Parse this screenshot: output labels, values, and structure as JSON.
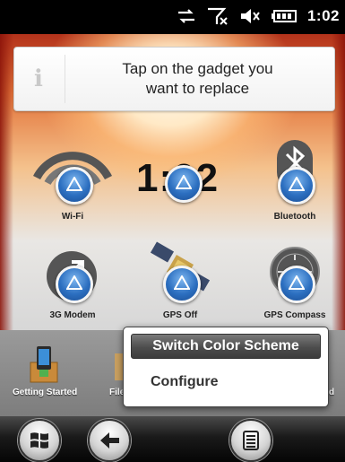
{
  "status_bar": {
    "time": "1:02",
    "icons": [
      "sync-arrows-icon",
      "no-signal-icon",
      "volume-muted-icon",
      "battery-icon"
    ]
  },
  "banner": {
    "icon": "info-icon",
    "line1": "Tap on the gadget you",
    "line2": "want to replace"
  },
  "gadgets": {
    "wifi": {
      "label": "Wi-Fi",
      "icon": "wifi-icon"
    },
    "clock": {
      "text": "1:02"
    },
    "bluetooth": {
      "label": "Bluetooth",
      "icon": "bluetooth-icon"
    },
    "modem": {
      "label": "3G Modem",
      "icon": "modem-icon"
    },
    "gps": {
      "label": "GPS Off",
      "icon": "satellite-icon"
    },
    "compass": {
      "label": "GPS Compass",
      "icon": "compass-icon"
    }
  },
  "launcher": {
    "items": [
      {
        "label": "Getting Started",
        "icon": "getting-started-icon"
      },
      {
        "label": "File",
        "icon": "file-icon"
      },
      {
        "label": "d",
        "icon": ""
      }
    ]
  },
  "context_menu": {
    "items": [
      {
        "label": "Switch Color Scheme",
        "selected": true
      },
      {
        "label": "Configure",
        "selected": false
      }
    ]
  },
  "navbar": {
    "start": "windows-start-icon",
    "back": "back-arrow-icon",
    "menu": "menu-icon"
  },
  "colors": {
    "marker_blue": "#2c6fc0",
    "accent_red": "#b3321b"
  }
}
